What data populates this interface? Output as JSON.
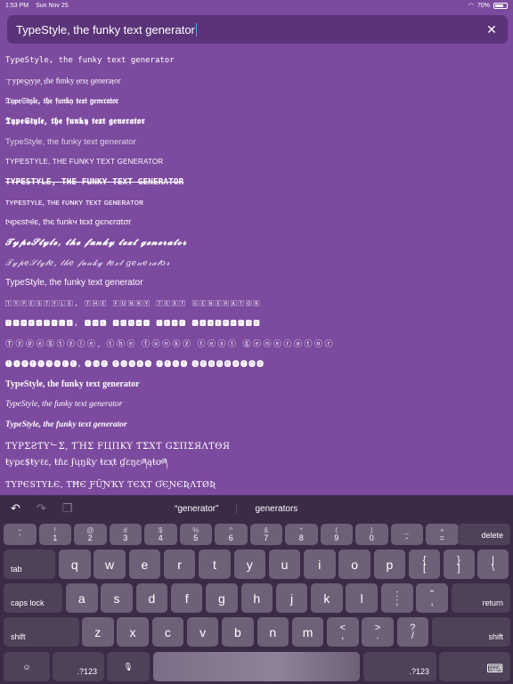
{
  "status_bar": {
    "time": "1:53 PM",
    "date": "Sun Nov 25",
    "battery": "70%"
  },
  "search": {
    "value": "TypeStyle, the funky text generator",
    "clear_icon": "close-icon"
  },
  "results": [
    "TypeStyle, the funky text generator",
    "ɹoʇɐɹǝuǝƃ ʇxǝʇ ʎʞunɟ ǝɥʇ 'ǝlʎʇSǝdʎ⊥",
    "𝔗𝔶𝔭𝔢𝔖𝔱𝔶𝔩𝔢, 𝔱𝔥𝔢 𝔣𝔲𝔫𝔨𝔶 𝔱𝔢𝔵𝔱 𝔤𝔢𝔫𝔢𝔯𝔞𝔱𝔬𝔯",
    "𝕿𝖞𝖕𝖊𝕾𝖙𝖞𝖑𝖊, 𝖙𝖍𝖊 𝖋𝖚𝖓𝖐𝖞 𝖙𝖊𝖝𝖙 𝖌𝖊𝖓𝖊𝖗𝖆𝖙𝖔𝖗",
    "TypeStyle, the funky text generator",
    "TYPESTYLE, THE FUNKY TEXT GENERATOR",
    "TYPESTYLE, THE FUNKY TEXT GENERATOR",
    "ᴛʏᴘᴇsᴛʏʟᴇ, ᴛʜᴇ ғᴜɴᴋʏ ᴛᴇxᴛ ɢᴇɴᴇʀᴀᴛᴏʀ",
    "tчpєѕtчlє, thє funkч tєхt gєnєrαtσr",
    "𝓣𝔂𝓹𝓮𝓢𝓽𝔂𝓵𝓮, 𝓽𝓱𝓮 𝓯𝓾𝓷𝓴𝔂 𝓽𝓮𝔁𝓽 𝓰𝓮𝓷𝓮𝓻𝓪𝓽𝓸𝓻",
    "𝒯𝓎𝓅𝑒𝒮𝓉𝓎𝓁𝑒, 𝓉𝒽𝑒 𝒻𝓊𝓃𝓀𝓎 𝓉𝑒𝓍𝓉 𝑔𝑒𝓃𝑒𝓇𝒶𝓉𝑜𝓇",
    "TypeStyle, the funky text generator",
    "🅃🅈🄿🄴🅂🅃🅈🄻🄴, 🅃🄷🄴 🄵🅄🄽🄺🅈 🅃🄴🅇🅃 🄶🄴🄽🄴🅁🄰🅃🄾🅁",
    "🆃🆈🅿🅴🆂🆃🆈🅻🅴, 🆃🅷🅴 🅵🆄🅽🅺🆈 🆃🅴🆇🆃 🅶🅴🅽🅴🆁🅰🆃🅾🆁",
    "ⓉⓨⓟⓔⓈⓣⓨⓛⓔ, ⓣⓗⓔ ⓕⓤⓝⓚⓨ ⓣⓔⓧⓣ ⓖⓔⓝⓔⓡⓐⓣⓞⓡ",
    "🅣🅨🅟🅔🅢🅣🅨🅛🅔, 🅣🅗🅔 🅕🅤🅝🅚🅨 🅣🅔🅧🅣 🅖🅔🅝🅔🅡🅐🅣🅞🅡",
    "TypeStyle, the funky text generator",
    "TypeStyle, the funky text generator",
    "TypeStyle, the funky text generator",
    "ƬYPΣƧƬYᄂΣ, ƬΉΣ FЦПKY ƬΣXƬ GΣПΣЯΛƬӨЯ",
    "ŧƴρɛ$ŧƴℓɛ, ŧɦɛ ʄųŋƙƴ ŧɛҳŧ ɠɛŋɛཞąŧơཞ",
    "ƬYPЄSƬYŁЄ, ƬĦЄ ƑỮƝҠY ƬЄҲƬ ƓЄƝЄƦΛƬØƦ"
  ],
  "keyboard": {
    "toolbar": {
      "undo_icon": "undo-icon",
      "redo_icon": "redo-icon",
      "paste_icon": "paste-icon"
    },
    "suggestions": [
      "“generator”",
      "generators"
    ],
    "row1": [
      {
        "top": "~",
        "bot": "`"
      },
      {
        "top": "!",
        "bot": "1"
      },
      {
        "top": "@",
        "bot": "2"
      },
      {
        "top": "#",
        "bot": "3"
      },
      {
        "top": "$",
        "bot": "4"
      },
      {
        "top": "%",
        "bot": "5"
      },
      {
        "top": "^",
        "bot": "6"
      },
      {
        "top": "&",
        "bot": "7"
      },
      {
        "top": "*",
        "bot": "8"
      },
      {
        "top": "(",
        "bot": "9"
      },
      {
        "top": ")",
        "bot": "0"
      },
      {
        "top": "_",
        "bot": "-"
      },
      {
        "top": "+",
        "bot": "="
      }
    ],
    "delete": "delete",
    "tab": "tab",
    "row2": [
      "q",
      "w",
      "e",
      "r",
      "t",
      "y",
      "u",
      "i",
      "o",
      "p"
    ],
    "row2_extra": [
      {
        "top": "{",
        "bot": "["
      },
      {
        "top": "}",
        "bot": "]"
      },
      {
        "top": "|",
        "bot": "\\"
      }
    ],
    "caps_lock": "caps lock",
    "row3": [
      "a",
      "s",
      "d",
      "f",
      "g",
      "h",
      "j",
      "k",
      "l"
    ],
    "row3_extra": [
      {
        "top": ":",
        "bot": ";"
      },
      {
        "top": "\"",
        "bot": ","
      }
    ],
    "return": "return",
    "shift": "shift",
    "row4": [
      "z",
      "x",
      "c",
      "v",
      "b",
      "n",
      "m"
    ],
    "row4_extra": [
      {
        "top": "<",
        "bot": ","
      },
      {
        "top": ">",
        "bot": "."
      },
      {
        "top": "?",
        "bot": "/"
      }
    ],
    "numbers_label": ".?123",
    "emoji_icon": "emoji-icon",
    "mic_icon": "microphone-icon",
    "hide_keyboard_icon": "keyboard-dismiss-icon"
  }
}
